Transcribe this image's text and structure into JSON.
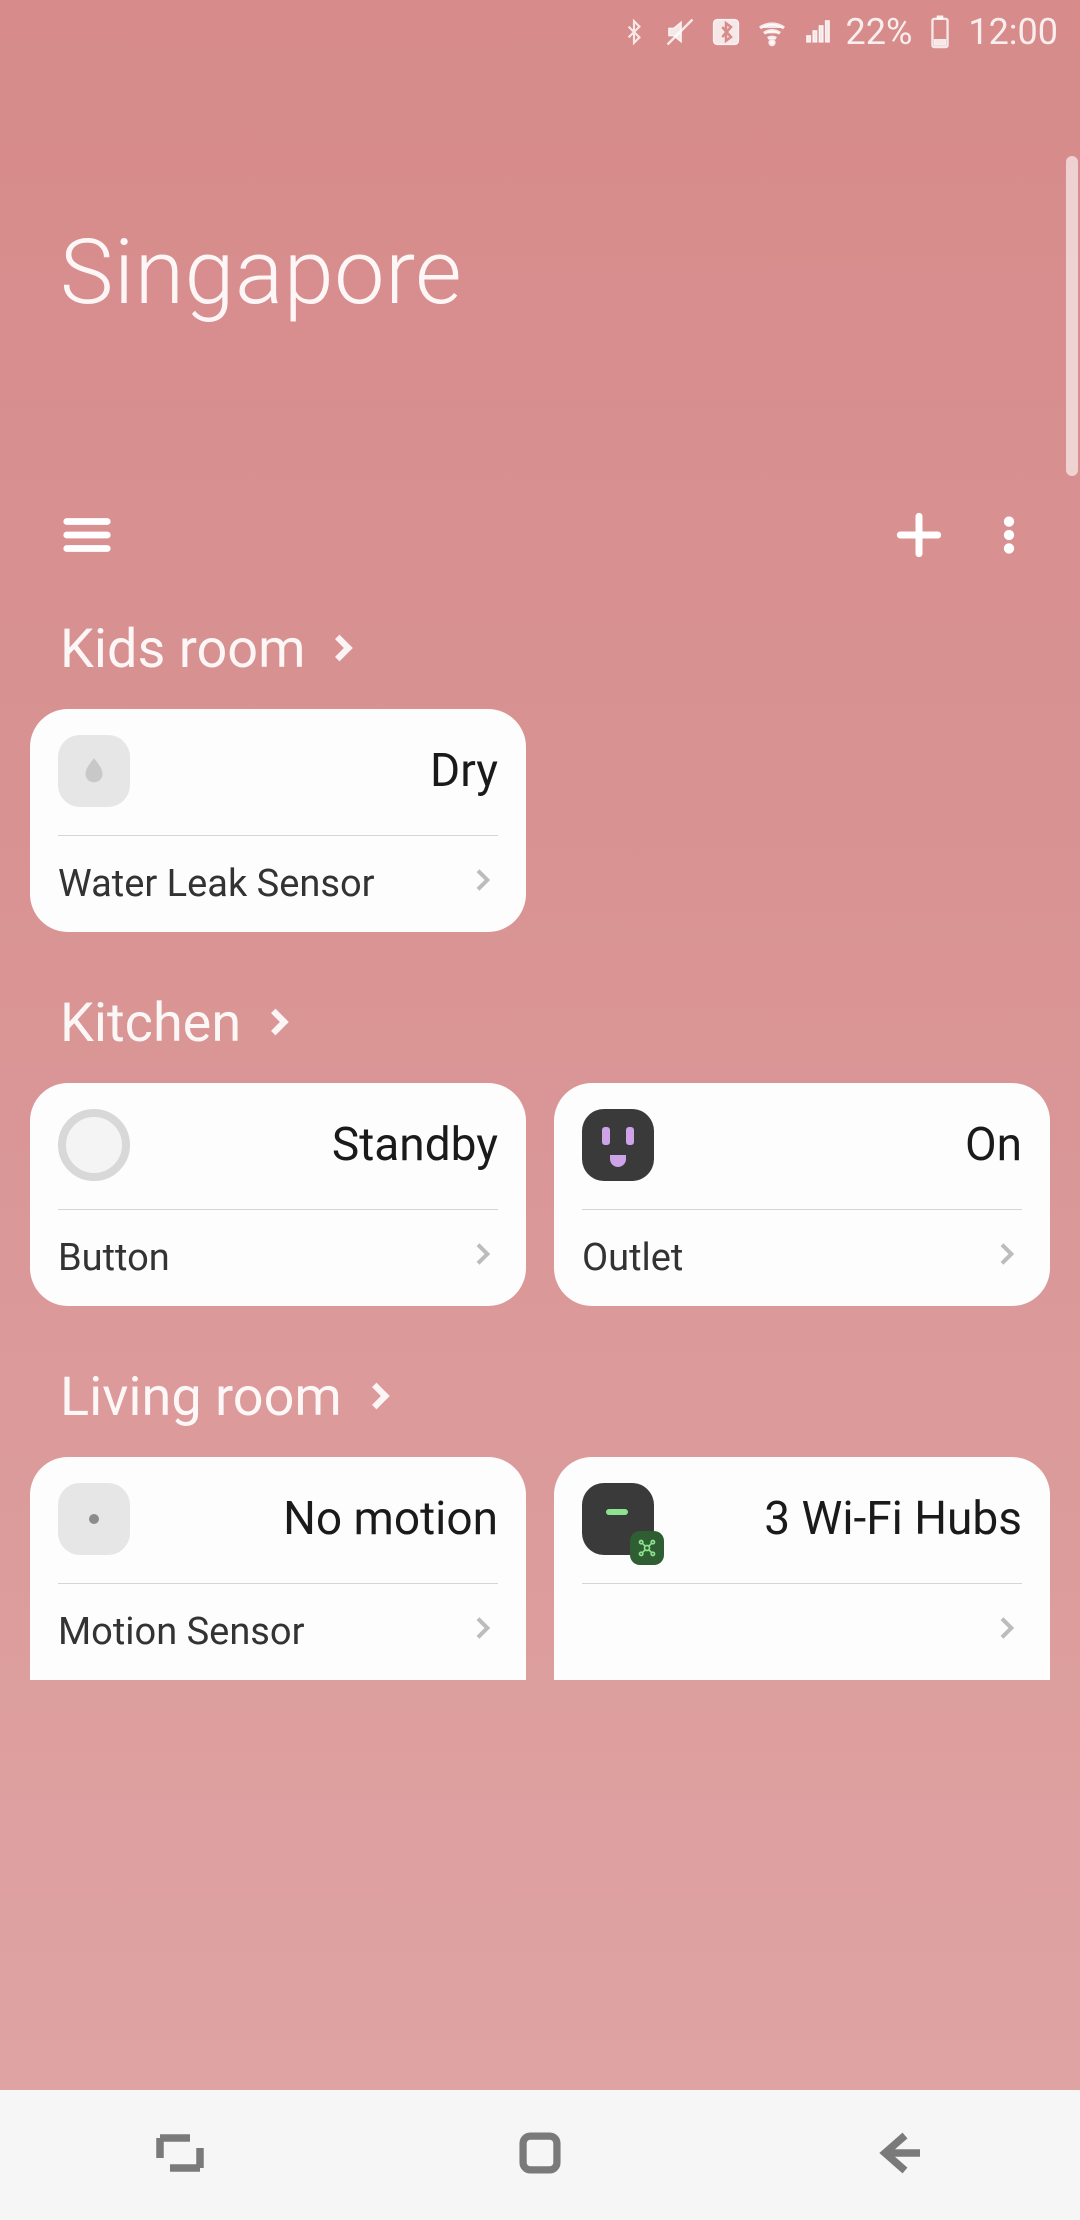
{
  "status": {
    "battery_pct": "22%",
    "time": "12:00"
  },
  "page_title": "Singapore",
  "rooms": [
    {
      "name": "Kids room",
      "devices": [
        {
          "icon": "water-drop-icon",
          "status": "Dry",
          "label": "Water Leak Sensor"
        }
      ]
    },
    {
      "name": "Kitchen",
      "devices": [
        {
          "icon": "button-icon",
          "status": "Standby",
          "label": "Button"
        },
        {
          "icon": "outlet-icon",
          "status": "On",
          "label": "Outlet"
        }
      ]
    },
    {
      "name": "Living room",
      "devices": [
        {
          "icon": "motion-icon",
          "status": "No motion",
          "label": "Motion Sensor"
        },
        {
          "icon": "hub-icon",
          "status": "3 Wi-Fi Hubs",
          "label": ""
        }
      ]
    }
  ]
}
